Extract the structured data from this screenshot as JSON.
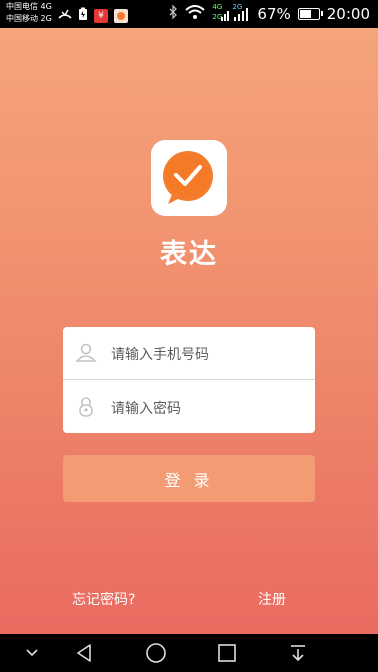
{
  "status_bar": {
    "carrier_line1": "中国电信 4G",
    "carrier_line2": "中国移动 2G",
    "network_top": "4G",
    "network_bottom": "2G",
    "network_top2": "2G",
    "battery_percent": "67%",
    "battery_level": 0.67,
    "time": "20:00",
    "icons": [
      "missed-call-icon",
      "battery-saver-icon",
      "yuan-app-icon",
      "orange-app-icon",
      "bluetooth-icon",
      "wifi-icon",
      "signal-icon",
      "battery-icon"
    ]
  },
  "app": {
    "name": "表达",
    "icon": "chat-bubble-checkmark-icon"
  },
  "form": {
    "phone_placeholder": "请输入手机号码",
    "password_placeholder": "请输入密码",
    "login_label": "登 录"
  },
  "links": {
    "forgot_password": "忘记密码?",
    "register": "注册"
  },
  "nav": {
    "icons": [
      "chevron-down-icon",
      "back-icon",
      "home-icon",
      "recents-icon",
      "notification-pulldown-icon"
    ]
  },
  "colors": {
    "gradient_top": "#f5a57a",
    "gradient_bottom": "#e96b61",
    "login_button": "#f39c74",
    "icon_orange": "#f37d2c"
  }
}
